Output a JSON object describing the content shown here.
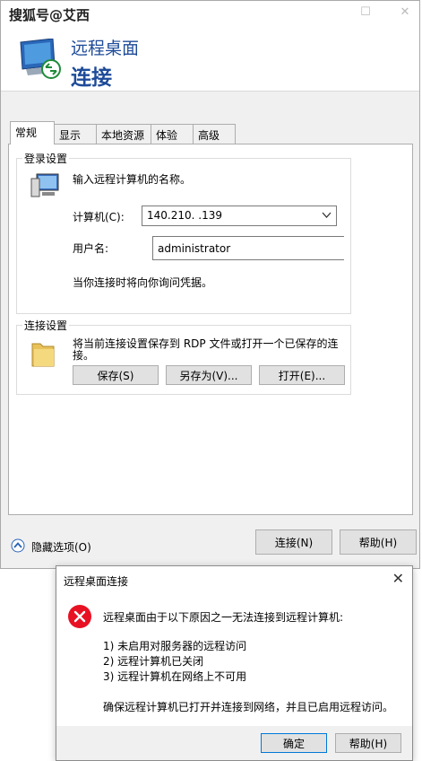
{
  "watermark": "搜狐号@艾西",
  "window": {
    "title": "远程桌面",
    "subtitle": "连接"
  },
  "tabs": [
    {
      "label": "常规",
      "active": true
    },
    {
      "label": "显示"
    },
    {
      "label": "本地资源"
    },
    {
      "label": "体验"
    },
    {
      "label": "高级"
    }
  ],
  "login": {
    "group_title": "登录设置",
    "prompt": "输入远程计算机的名称。",
    "computer_label": "计算机(C):",
    "computer_value": "140.210.  .139",
    "username_label": "用户名:",
    "username_value": "administrator",
    "credential_note": "当你连接时将向你询问凭据。"
  },
  "connection": {
    "group_title": "连接设置",
    "desc_line1": "将当前连接设置保存到 RDP 文件或打开一个已保存的连",
    "desc_line2": "接。",
    "save_label": "保存(S)",
    "save_as_label": "另存为(V)...",
    "open_label": "打开(E)..."
  },
  "footer": {
    "hide_options": "隐藏选项(O)",
    "connect_label": "连接(N)",
    "help_label": "帮助(H)"
  },
  "error_dialog": {
    "title": "远程桌面连接",
    "message": "远程桌面由于以下原因之一无法连接到远程计算机:",
    "reasons": [
      "1) 未启用对服务器的远程访问",
      "2) 远程计算机已关闭",
      "3) 远程计算机在网络上不可用"
    ],
    "advice": "确保远程计算机已打开并连接到网络，并且已启用远程访问。",
    "ok_label": "确定",
    "help_label": "帮助(H)"
  },
  "colors": {
    "title_blue": "#1e4b99",
    "error_red": "#e81123",
    "focus_blue": "#0078d7"
  }
}
